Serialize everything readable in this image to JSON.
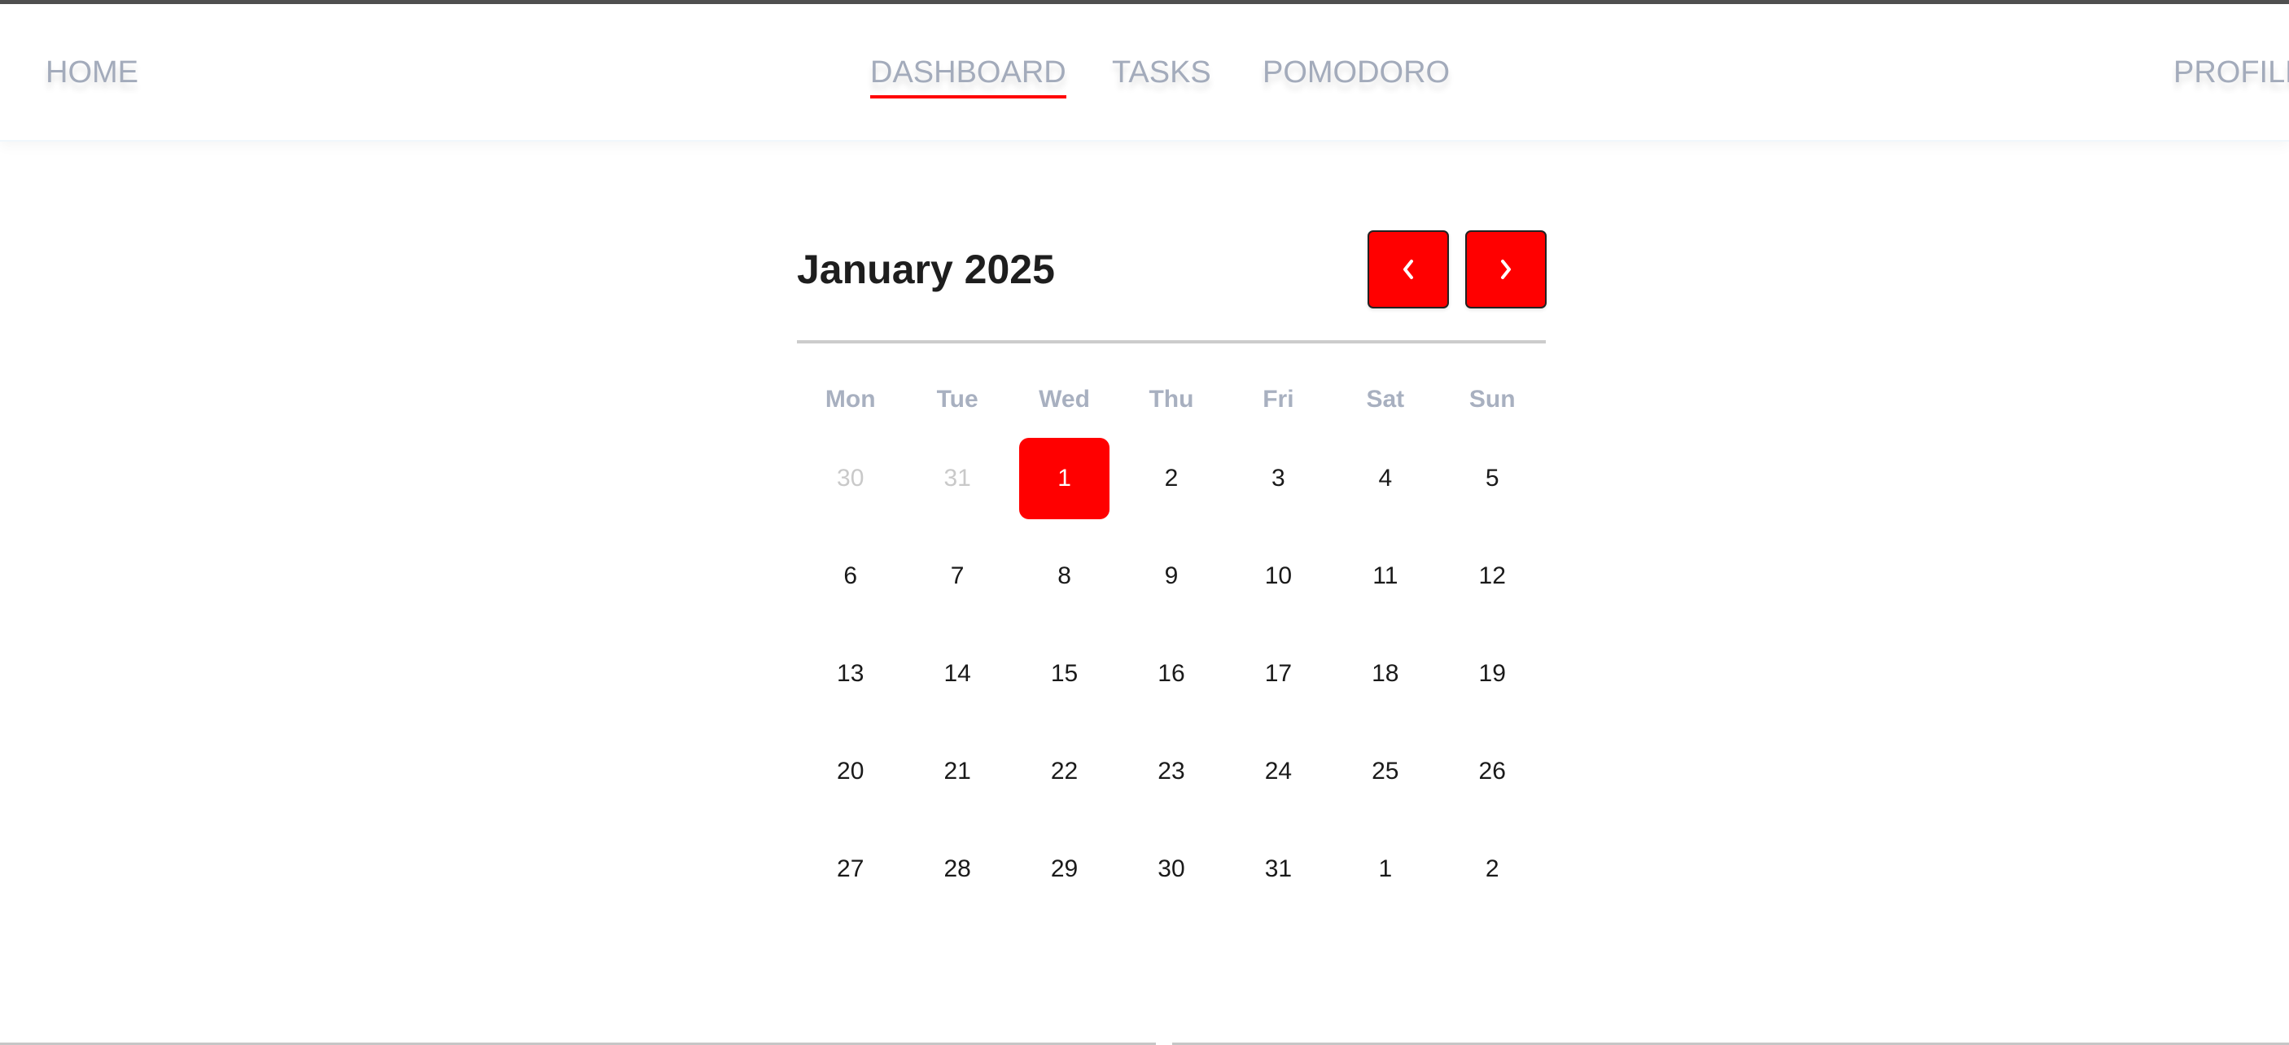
{
  "nav": {
    "home": "HOME",
    "dashboard": "DASHBOARD",
    "tasks": "TASKS",
    "pomodoro": "POMODORO",
    "profile": "PROFILE",
    "active": "DASHBOARD"
  },
  "calendar": {
    "title": "January 2025",
    "prev_icon": "chevron-left-icon",
    "next_icon": "chevron-right-icon",
    "weekdays": [
      "Mon",
      "Tue",
      "Wed",
      "Thu",
      "Fri",
      "Sat",
      "Sun"
    ],
    "selected": "1",
    "weeks": [
      [
        {
          "d": "30",
          "muted": true
        },
        {
          "d": "31",
          "muted": true
        },
        {
          "d": "1",
          "selected": true
        },
        {
          "d": "2"
        },
        {
          "d": "3"
        },
        {
          "d": "4"
        },
        {
          "d": "5"
        }
      ],
      [
        {
          "d": "6"
        },
        {
          "d": "7"
        },
        {
          "d": "8"
        },
        {
          "d": "9"
        },
        {
          "d": "10"
        },
        {
          "d": "11"
        },
        {
          "d": "12"
        }
      ],
      [
        {
          "d": "13"
        },
        {
          "d": "14"
        },
        {
          "d": "15"
        },
        {
          "d": "16"
        },
        {
          "d": "17"
        },
        {
          "d": "18"
        },
        {
          "d": "19"
        }
      ],
      [
        {
          "d": "20"
        },
        {
          "d": "21"
        },
        {
          "d": "22"
        },
        {
          "d": "23"
        },
        {
          "d": "24"
        },
        {
          "d": "25"
        },
        {
          "d": "26"
        }
      ],
      [
        {
          "d": "27"
        },
        {
          "d": "28"
        },
        {
          "d": "29"
        },
        {
          "d": "30"
        },
        {
          "d": "31"
        },
        {
          "d": "1"
        },
        {
          "d": "2"
        }
      ]
    ]
  },
  "colors": {
    "accent": "#ff0000",
    "nav_text": "#a3abbb",
    "weekday_text": "#a8b0c0",
    "muted_day": "#c9c9c9"
  }
}
